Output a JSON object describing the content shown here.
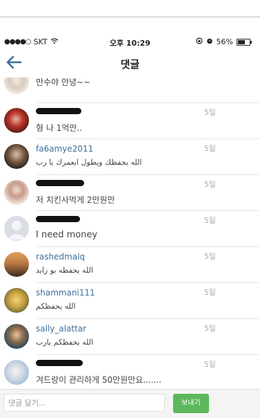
{
  "status_bar": {
    "carrier": "SKT",
    "time": "오후 10:29",
    "battery": "56%",
    "battery_level": 0.56
  },
  "nav": {
    "title": "댓글"
  },
  "comments": [
    {
      "username": "",
      "text": "만수야 안녕~~",
      "time": "",
      "redacted": true,
      "rtl": false
    },
    {
      "username": "",
      "text": "형 나 1억만..",
      "time": "5일",
      "redacted": true,
      "rtl": false
    },
    {
      "username": "fa6amye2011",
      "text": "الله يحفظك ويطول ابعمرك يا رب",
      "time": "5일",
      "redacted": false,
      "rtl": true
    },
    {
      "username": "",
      "text": "저 치킨사먹게 2만원만",
      "time": "5일",
      "redacted": true,
      "rtl": false
    },
    {
      "username": "",
      "text": "I need money",
      "time": "5일",
      "redacted": true,
      "rtl": false
    },
    {
      "username": "rashedmalq",
      "text": "الله يحفظه بو زايد",
      "time": "5일",
      "redacted": false,
      "rtl": true
    },
    {
      "username": "shammani111",
      "text": "الله يحفظكم",
      "time": "5일",
      "redacted": false,
      "rtl": true
    },
    {
      "username": "sally_alattar",
      "text": "الله يحفظكم يارب",
      "time": "5일",
      "redacted": false,
      "rtl": true
    },
    {
      "username": "",
      "text": "겨드랑이 관리하게 50만원만요.......",
      "time": "5일",
      "redacted": true,
      "rtl": false
    }
  ],
  "composer": {
    "placeholder": "댓글 달기...",
    "send_label": "보내기"
  },
  "colors": {
    "accent": "#3d6f99",
    "send": "#5cb85c"
  }
}
